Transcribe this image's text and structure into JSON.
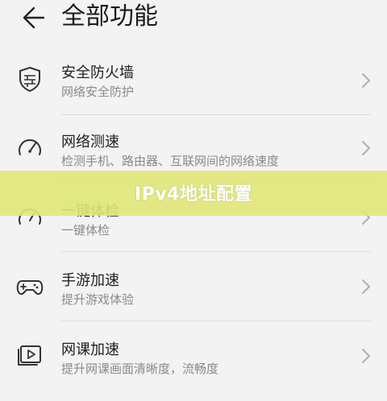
{
  "header": {
    "title": "全部功能",
    "back_icon": "back-arrow-icon"
  },
  "items": [
    {
      "label": "安全防火墙",
      "sub": "网络安全防护",
      "icon": "firewall-icon"
    },
    {
      "label": "网络测速",
      "sub": "检测手机、路由器、互联网间的网络速度",
      "icon": "speedometer-icon"
    },
    {
      "label": "一键体检",
      "sub": "一键体检",
      "icon": "gauge-icon"
    },
    {
      "label": "手游加速",
      "sub": "提升游戏体验",
      "icon": "gamepad-icon"
    },
    {
      "label": "网课加速",
      "sub": "提升网课画面清晰度，流畅度",
      "icon": "video-class-icon"
    }
  ],
  "banner": {
    "text": "IPv4地址配置"
  },
  "colors": {
    "background": "#f3f3f3",
    "banner": "#e0e878",
    "subtext": "#8a8a8a"
  }
}
